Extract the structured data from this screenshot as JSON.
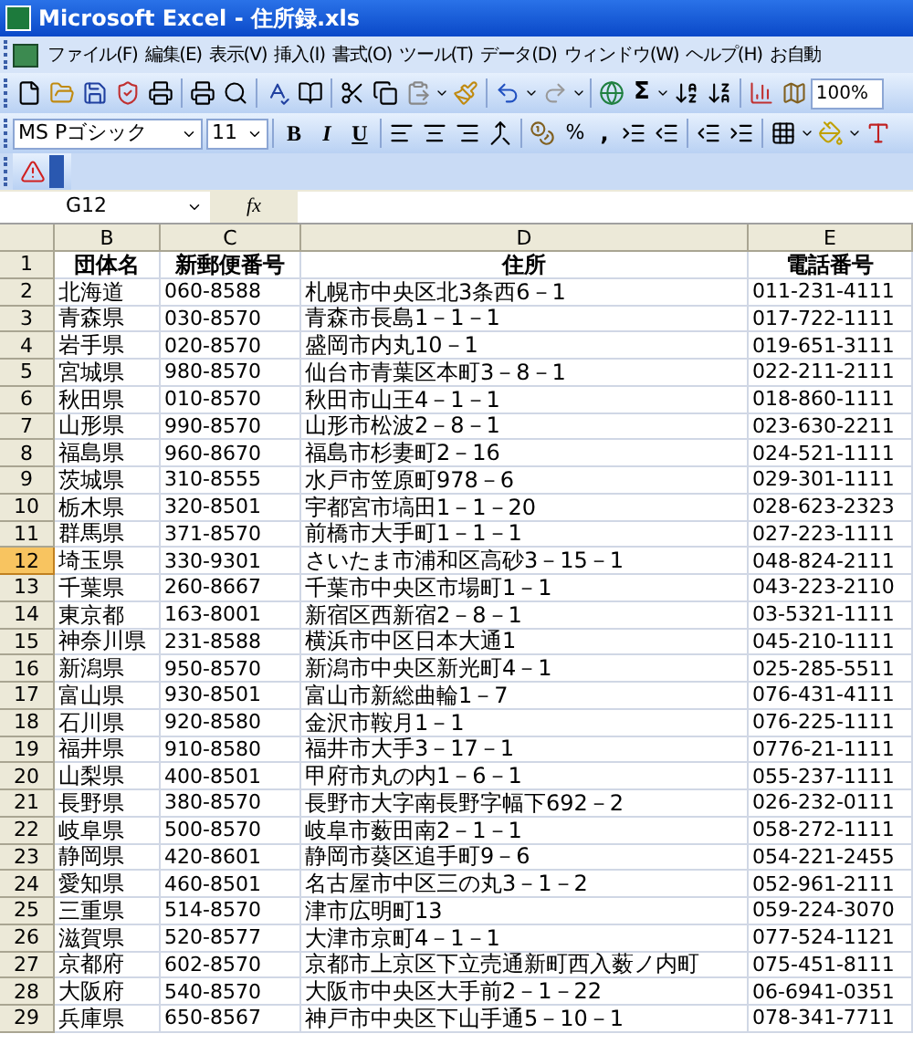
{
  "window": {
    "title": "Microsoft Excel - 住所録.xls"
  },
  "menu": [
    "ファイル(F)",
    "編集(E)",
    "表示(V)",
    "挿入(I)",
    "書式(O)",
    "ツール(T)",
    "データ(D)",
    "ウィンドウ(W)",
    "ヘルプ(H)",
    "お自動"
  ],
  "standard_toolbar": {
    "sigma": "Σ",
    "zoom": "100%"
  },
  "format_toolbar": {
    "font": "MS Pゴシック",
    "size": "11",
    "bold": "B",
    "italic": "I",
    "underline": "U",
    "percent": "%",
    "comma": ","
  },
  "formula_bar": {
    "name_box": "G12",
    "fx": "fx"
  },
  "sheet": {
    "columns": [
      "B",
      "C",
      "D",
      "E"
    ],
    "rows": [
      {
        "number": "1",
        "kind": "header",
        "active": false,
        "cells": [
          "団体名",
          "新郵便番号",
          "住所",
          "電話番号"
        ]
      },
      {
        "number": "2",
        "kind": "data",
        "active": false,
        "cells": [
          "北海道",
          "060-8588",
          "札幌市中央区北3条西6－1",
          "011-231-4111"
        ]
      },
      {
        "number": "3",
        "kind": "data",
        "active": false,
        "cells": [
          "青森県",
          "030-8570",
          "青森市長島1－1－1",
          "017-722-1111"
        ]
      },
      {
        "number": "4",
        "kind": "data",
        "active": false,
        "cells": [
          "岩手県",
          "020-8570",
          "盛岡市内丸10－1",
          "019-651-3111"
        ]
      },
      {
        "number": "5",
        "kind": "data",
        "active": false,
        "cells": [
          "宮城県",
          "980-8570",
          "仙台市青葉区本町3－8－1",
          "022-211-2111"
        ]
      },
      {
        "number": "6",
        "kind": "data",
        "active": false,
        "cells": [
          "秋田県",
          "010-8570",
          "秋田市山王4－1－1",
          "018-860-1111"
        ]
      },
      {
        "number": "7",
        "kind": "data",
        "active": false,
        "cells": [
          "山形県",
          "990-8570",
          "山形市松波2－8－1",
          "023-630-2211"
        ]
      },
      {
        "number": "8",
        "kind": "data",
        "active": false,
        "cells": [
          "福島県",
          "960-8670",
          "福島市杉妻町2－16",
          "024-521-1111"
        ]
      },
      {
        "number": "9",
        "kind": "data",
        "active": false,
        "cells": [
          "茨城県",
          "310-8555",
          "水戸市笠原町978－6",
          "029-301-1111"
        ]
      },
      {
        "number": "10",
        "kind": "data",
        "active": false,
        "cells": [
          "栃木県",
          "320-8501",
          "宇都宮市塙田1－1－20",
          "028-623-2323"
        ]
      },
      {
        "number": "11",
        "kind": "data",
        "active": false,
        "cells": [
          "群馬県",
          "371-8570",
          "前橋市大手町1－1－1",
          "027-223-1111"
        ]
      },
      {
        "number": "12",
        "kind": "data",
        "active": true,
        "cells": [
          "埼玉県",
          "330-9301",
          "さいたま市浦和区高砂3－15－1",
          "048-824-2111"
        ]
      },
      {
        "number": "13",
        "kind": "data",
        "active": false,
        "cells": [
          "千葉県",
          "260-8667",
          "千葉市中央区市場町1－1",
          "043-223-2110"
        ]
      },
      {
        "number": "14",
        "kind": "data",
        "active": false,
        "cells": [
          "東京都",
          "163-8001",
          "新宿区西新宿2－8－1",
          "03-5321-1111"
        ]
      },
      {
        "number": "15",
        "kind": "data",
        "active": false,
        "cells": [
          "神奈川県",
          "231-8588",
          "横浜市中区日本大通1",
          "045-210-1111"
        ]
      },
      {
        "number": "16",
        "kind": "data",
        "active": false,
        "cells": [
          "新潟県",
          "950-8570",
          "新潟市中央区新光町4－1",
          "025-285-5511"
        ]
      },
      {
        "number": "17",
        "kind": "data",
        "active": false,
        "cells": [
          "富山県",
          "930-8501",
          "富山市新総曲輪1－7",
          "076-431-4111"
        ]
      },
      {
        "number": "18",
        "kind": "data",
        "active": false,
        "cells": [
          "石川県",
          "920-8580",
          "金沢市鞍月1－1",
          "076-225-1111"
        ]
      },
      {
        "number": "19",
        "kind": "data",
        "active": false,
        "cells": [
          "福井県",
          "910-8580",
          "福井市大手3－17－1",
          "0776-21-1111"
        ]
      },
      {
        "number": "20",
        "kind": "data",
        "active": false,
        "cells": [
          "山梨県",
          "400-8501",
          "甲府市丸の内1－6－1",
          "055-237-1111"
        ]
      },
      {
        "number": "21",
        "kind": "data",
        "active": false,
        "cells": [
          "長野県",
          "380-8570",
          "長野市大字南長野字幅下692－2",
          "026-232-0111"
        ]
      },
      {
        "number": "22",
        "kind": "data",
        "active": false,
        "cells": [
          "岐阜県",
          "500-8570",
          "岐阜市薮田南2－1－1",
          "058-272-1111"
        ]
      },
      {
        "number": "23",
        "kind": "data",
        "active": false,
        "cells": [
          "静岡県",
          "420-8601",
          "静岡市葵区追手町9－6",
          "054-221-2455"
        ]
      },
      {
        "number": "24",
        "kind": "data",
        "active": false,
        "cells": [
          "愛知県",
          "460-8501",
          "名古屋市中区三の丸3－1－2",
          "052-961-2111"
        ]
      },
      {
        "number": "25",
        "kind": "data",
        "active": false,
        "cells": [
          "三重県",
          "514-8570",
          "津市広明町13",
          "059-224-3070"
        ]
      },
      {
        "number": "26",
        "kind": "data",
        "active": false,
        "cells": [
          "滋賀県",
          "520-8577",
          "大津市京町4－1－1",
          "077-524-1121"
        ]
      },
      {
        "number": "27",
        "kind": "data",
        "active": false,
        "cells": [
          "京都府",
          "602-8570",
          "京都市上京区下立売通新町西入薮ノ内町",
          "075-451-8111"
        ]
      },
      {
        "number": "28",
        "kind": "data",
        "active": false,
        "cells": [
          "大阪府",
          "540-8570",
          "大阪市中央区大手前2－1－22",
          "06-6941-0351"
        ]
      },
      {
        "number": "29",
        "kind": "data",
        "active": false,
        "cells": [
          "兵庫県",
          "650-8567",
          "神戸市中央区下山手通5－10－1",
          "078-341-7711"
        ]
      }
    ]
  }
}
